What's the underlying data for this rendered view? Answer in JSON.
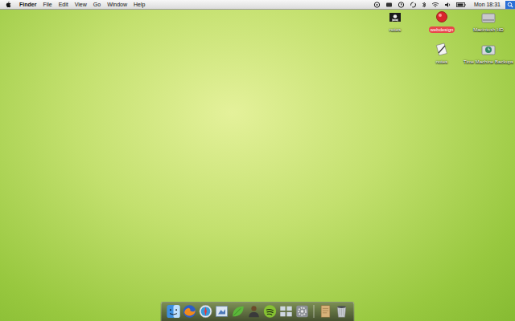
{
  "menu_bar": {
    "app": "Finder",
    "menus": [
      "File",
      "Edit",
      "View",
      "Go",
      "Window",
      "Help"
    ],
    "clock": "Mon 18:31"
  },
  "desktop_icons": [
    {
      "label": "Macintosh HD",
      "kind": "disk",
      "color": null
    },
    {
      "label": "Time Machine Backups",
      "kind": "backup",
      "color": null
    },
    {
      "label": "webdesign",
      "kind": "folder",
      "color": "#e8474a"
    },
    {
      "label": "notes",
      "kind": "file",
      "color": null
    },
    {
      "label": "notes",
      "kind": "flag",
      "color": null
    }
  ]
}
